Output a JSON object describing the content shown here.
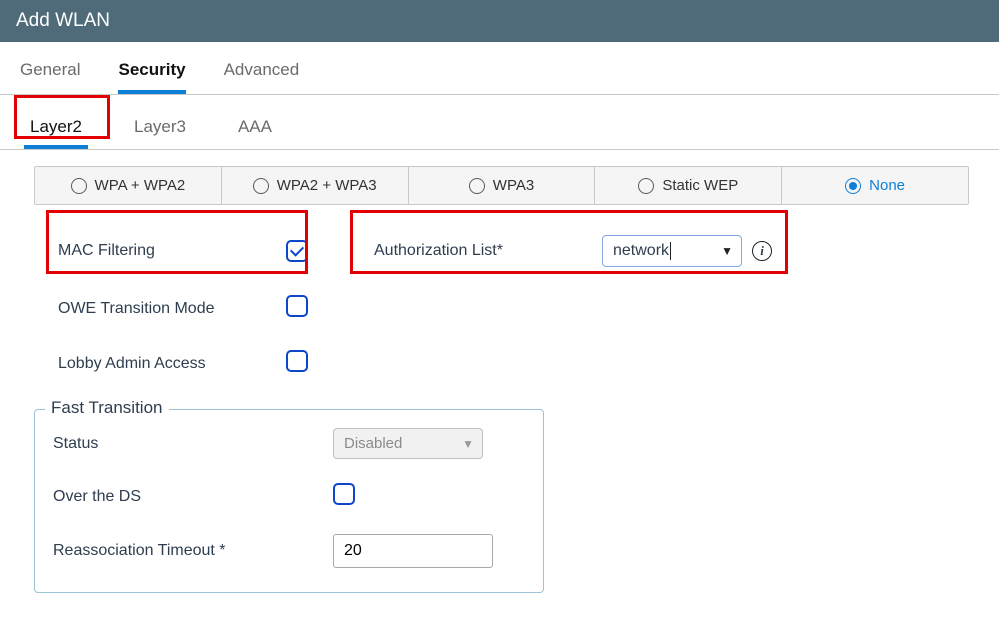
{
  "header": {
    "title": "Add WLAN"
  },
  "tabs": {
    "general": "General",
    "security": "Security",
    "advanced": "Advanced",
    "active": "security"
  },
  "subtabs": {
    "layer2": "Layer2",
    "layer3": "Layer3",
    "aaa": "AAA",
    "active": "layer2"
  },
  "security_modes": {
    "wpa_wpa2": "WPA + WPA2",
    "wpa2_wpa3": "WPA2 + WPA3",
    "wpa3": "WPA3",
    "static_wep": "Static WEP",
    "none": "None",
    "selected": "none"
  },
  "fields": {
    "mac_filtering_label": "MAC Filtering",
    "mac_filtering_checked": true,
    "auth_list_label": "Authorization List*",
    "auth_list_value": "network",
    "owe_label": "OWE Transition Mode",
    "owe_checked": false,
    "lobby_label": "Lobby Admin Access",
    "lobby_checked": false
  },
  "fast_transition": {
    "legend": "Fast Transition",
    "status_label": "Status",
    "status_value": "Disabled",
    "over_ds_label": "Over the DS",
    "over_ds_checked": false,
    "reassoc_label": "Reassociation Timeout *",
    "reassoc_value": "20"
  }
}
